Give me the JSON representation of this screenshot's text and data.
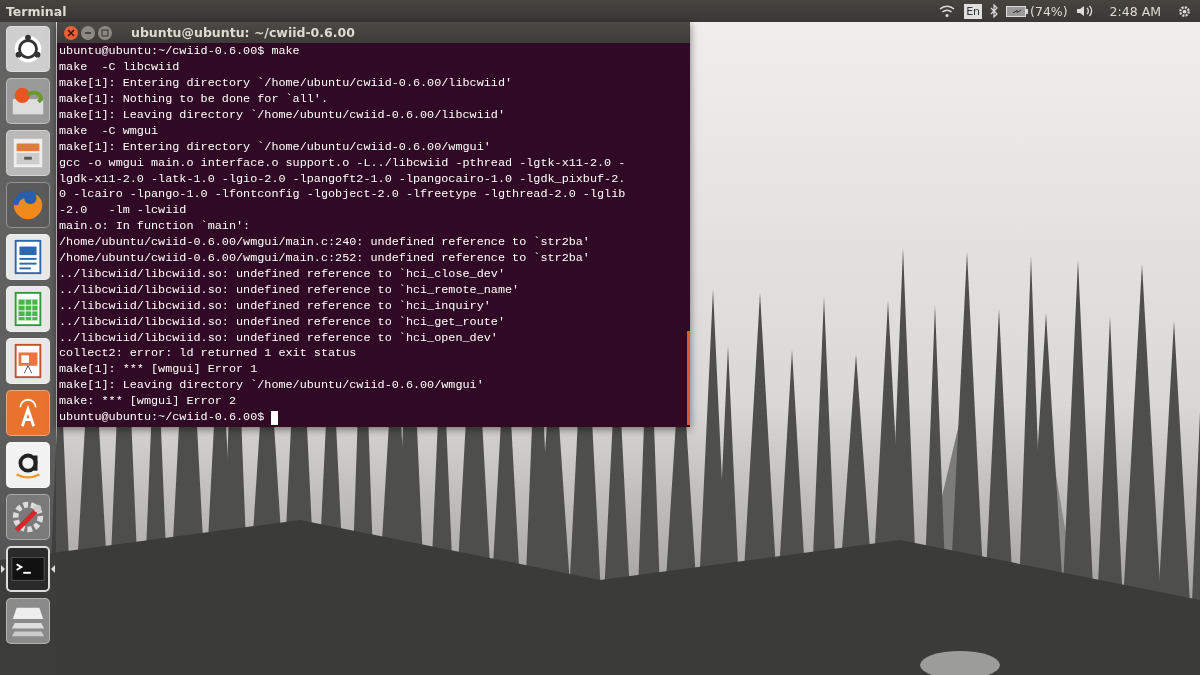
{
  "top_bar": {
    "app_title": "Terminal",
    "keyboard": "En",
    "battery": "(74%)",
    "clock": "2:48 AM"
  },
  "launcher": [
    {
      "kind": "dash",
      "running": false
    },
    {
      "kind": "installer",
      "running": false
    },
    {
      "kind": "files",
      "running": false
    },
    {
      "kind": "firefox",
      "running": false
    },
    {
      "kind": "writer",
      "running": false
    },
    {
      "kind": "calc",
      "running": false
    },
    {
      "kind": "impress",
      "running": false
    },
    {
      "kind": "software",
      "running": false
    },
    {
      "kind": "amazon",
      "running": false
    },
    {
      "kind": "settings",
      "running": false
    },
    {
      "kind": "terminal",
      "running": true
    },
    {
      "kind": "workspaces",
      "running": false
    }
  ],
  "terminal": {
    "title": "ubuntu@ubuntu: ~/cwiid-0.6.00",
    "prompt": "ubuntu@ubuntu:~/cwiid-0.6.00$ ",
    "lines": [
      "ubuntu@ubuntu:~/cwiid-0.6.00$ make",
      "make  -C libcwiid",
      "make[1]: Entering directory `/home/ubuntu/cwiid-0.6.00/libcwiid'",
      "make[1]: Nothing to be done for `all'.",
      "make[1]: Leaving directory `/home/ubuntu/cwiid-0.6.00/libcwiid'",
      "make  -C wmgui",
      "make[1]: Entering directory `/home/ubuntu/cwiid-0.6.00/wmgui'",
      "gcc -o wmgui main.o interface.o support.o -L../libcwiid -pthread -lgtk-x11-2.0 -",
      "lgdk-x11-2.0 -latk-1.0 -lgio-2.0 -lpangoft2-1.0 -lpangocairo-1.0 -lgdk_pixbuf-2.",
      "0 -lcairo -lpango-1.0 -lfontconfig -lgobject-2.0 -lfreetype -lgthread-2.0 -lglib",
      "-2.0   -lm -lcwiid",
      "main.o: In function `main':",
      "/home/ubuntu/cwiid-0.6.00/wmgui/main.c:240: undefined reference to `str2ba'",
      "/home/ubuntu/cwiid-0.6.00/wmgui/main.c:252: undefined reference to `str2ba'",
      "../libcwiid/libcwiid.so: undefined reference to `hci_close_dev'",
      "../libcwiid/libcwiid.so: undefined reference to `hci_remote_name'",
      "../libcwiid/libcwiid.so: undefined reference to `hci_inquiry'",
      "../libcwiid/libcwiid.so: undefined reference to `hci_get_route'",
      "../libcwiid/libcwiid.so: undefined reference to `hci_open_dev'",
      "collect2: error: ld returned 1 exit status",
      "make[1]: *** [wmgui] Error 1",
      "make[1]: Leaving directory `/home/ubuntu/cwiid-0.6.00/wmgui'",
      "make: *** [wmgui] Error 2"
    ]
  }
}
